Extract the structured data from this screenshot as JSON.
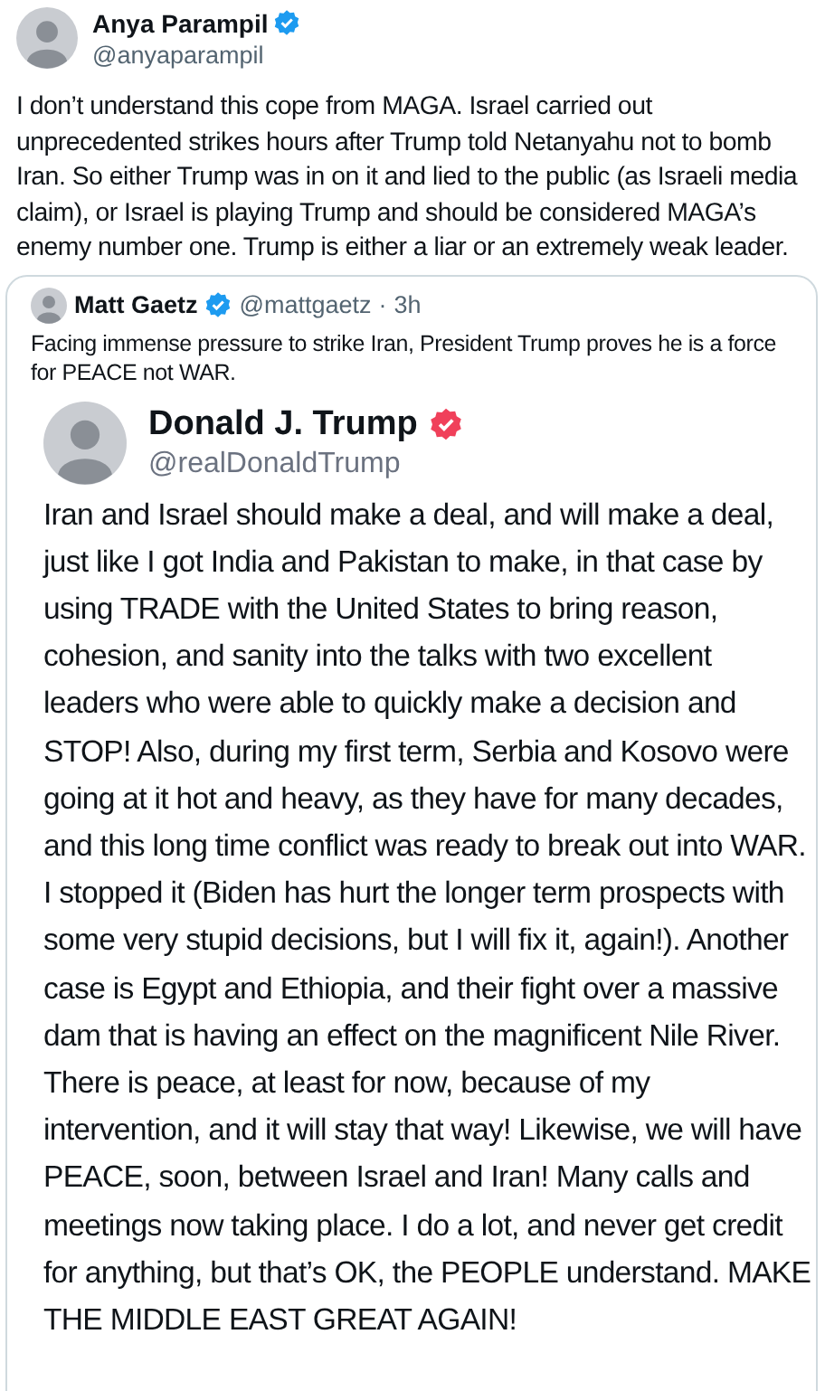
{
  "tweet": {
    "author": "Anya Parampil",
    "verified": true,
    "handle": "@anyaparampil",
    "text": "I don’t understand this cope from MAGA. Israel carried out unprecedented strikes hours after Trump told Netanyahu not to bomb Iran. So either Trump was in on it and lied to the public (as Israeli media claim), or Israel is playing Trump and should be considered MAGA’s enemy number one. Trump is either a liar or an extremely weak leader.",
    "quote": {
      "author": "Matt Gaetz",
      "verified": true,
      "handle": "@mattgaetz",
      "separator": "·",
      "time": "3h",
      "text": "Facing immense pressure to strike Iran, President Trump proves he is a force for PEACE not WAR.",
      "image": {
        "author": "Donald J. Trump",
        "verified": true,
        "handle": "@realDonaldTrump",
        "text": "Iran and Israel should make a deal, and will make a deal, just like I got India and Pakistan to make, in that case by using TRADE with the United States to bring reason, cohesion, and sanity into the talks with two excellent leaders who were able to quickly make a decision and STOP! Also, during my first term, Serbia and Kosovo were going at it hot and heavy, as they have for many decades, and this long time conflict was ready to break out into WAR. I stopped it (Biden has hurt the longer term prospects with some very stupid decisions, but I will fix it, again!). Another case is Egypt and Ethiopia, and their fight over a massive dam that is having an effect on the magnificent Nile River. There is peace, at least for now, because of my intervention, and it will stay that way! Likewise, we will have PEACE, soon, between Israel and Iran! Many calls and meetings now taking place. I do a lot, and never get credit for anything, but that’s OK, the PEOPLE understand. MAKE THE MIDDLE EAST GREAT AGAIN!"
      }
    }
  }
}
